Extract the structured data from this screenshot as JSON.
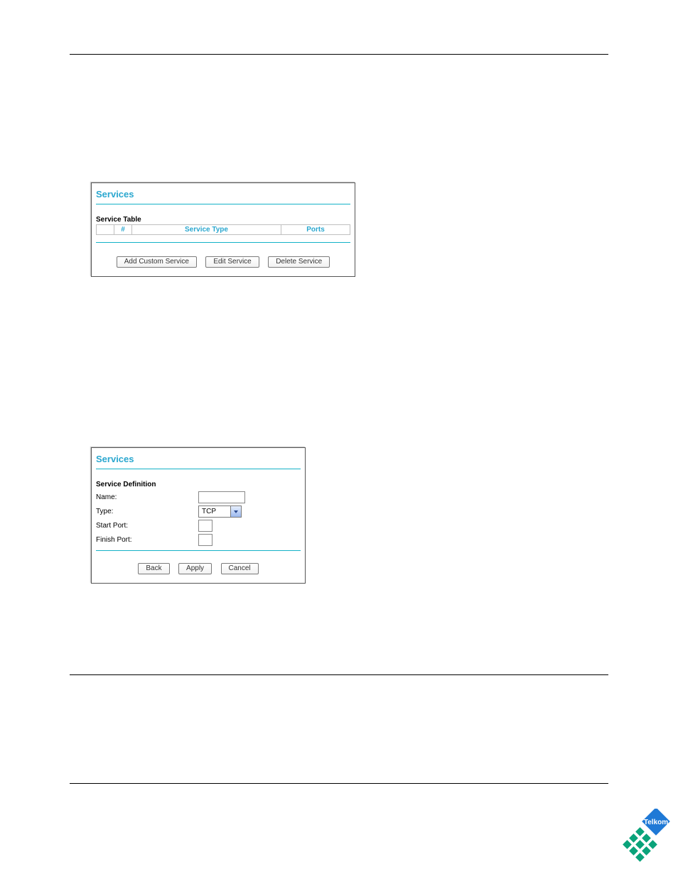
{
  "panels": {
    "services1": {
      "title": "Services",
      "section_label": "Service Table",
      "columns": {
        "hash": "#",
        "service_type": "Service Type",
        "ports": "Ports"
      },
      "buttons": {
        "add_custom": "Add Custom Service",
        "edit": "Edit Service",
        "delete": "Delete Service"
      }
    },
    "services2": {
      "title": "Services",
      "section_label": "Service Definition",
      "fields": {
        "name_label": "Name:",
        "name_value": "",
        "type_label": "Type:",
        "type_value": "TCP",
        "start_port_label": "Start Port:",
        "start_port_value": "",
        "finish_port_label": "Finish Port:",
        "finish_port_value": ""
      },
      "buttons": {
        "back": "Back",
        "apply": "Apply",
        "cancel": "Cancel"
      }
    }
  },
  "logo": {
    "text": "Telkom"
  }
}
